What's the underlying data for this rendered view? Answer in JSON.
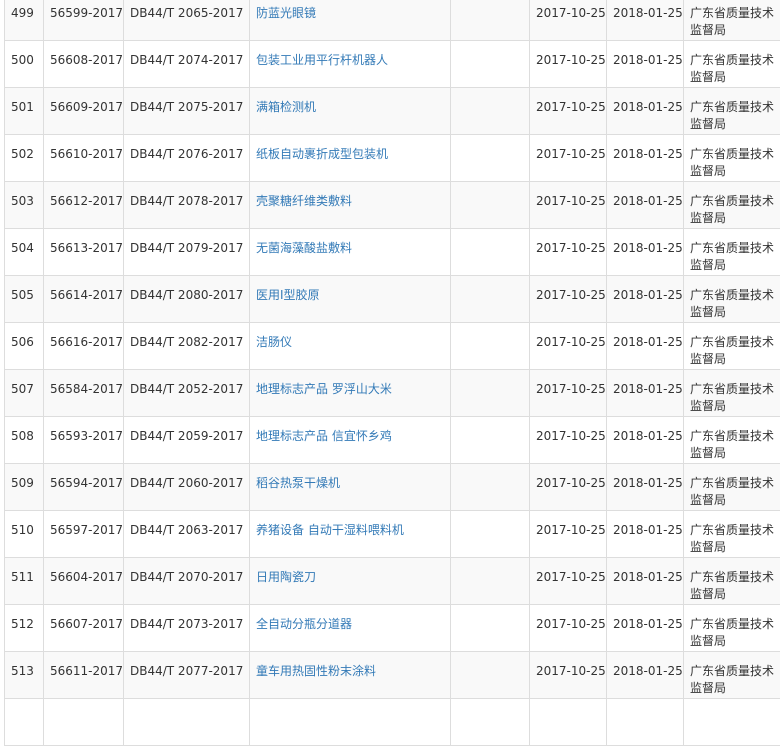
{
  "rows": [
    {
      "no": "499",
      "record": "56599-2017",
      "code": "DB44/T 2065-2017",
      "name": "防蓝光眼镜",
      "published": "2017-10-25",
      "implemented": "2018-01-25",
      "dept": "广东省质量技术监督局"
    },
    {
      "no": "500",
      "record": "56608-2017",
      "code": "DB44/T 2074-2017",
      "name": "包装工业用平行杆机器人",
      "published": "2017-10-25",
      "implemented": "2018-01-25",
      "dept": "广东省质量技术监督局"
    },
    {
      "no": "501",
      "record": "56609-2017",
      "code": "DB44/T 2075-2017",
      "name": "满箱检测机",
      "published": "2017-10-25",
      "implemented": "2018-01-25",
      "dept": "广东省质量技术监督局"
    },
    {
      "no": "502",
      "record": "56610-2017",
      "code": "DB44/T 2076-2017",
      "name": "纸板自动裹折成型包装机",
      "published": "2017-10-25",
      "implemented": "2018-01-25",
      "dept": "广东省质量技术监督局"
    },
    {
      "no": "503",
      "record": "56612-2017",
      "code": "DB44/T 2078-2017",
      "name": "壳聚糖纤维类敷料",
      "published": "2017-10-25",
      "implemented": "2018-01-25",
      "dept": "广东省质量技术监督局"
    },
    {
      "no": "504",
      "record": "56613-2017",
      "code": "DB44/T 2079-2017",
      "name": "无菌海藻酸盐敷料",
      "published": "2017-10-25",
      "implemented": "2018-01-25",
      "dept": "广东省质量技术监督局"
    },
    {
      "no": "505",
      "record": "56614-2017",
      "code": "DB44/T 2080-2017",
      "name": "医用Ⅰ型胶原",
      "published": "2017-10-25",
      "implemented": "2018-01-25",
      "dept": "广东省质量技术监督局"
    },
    {
      "no": "506",
      "record": "56616-2017",
      "code": "DB44/T 2082-2017",
      "name": "洁肠仪",
      "published": "2017-10-25",
      "implemented": "2018-01-25",
      "dept": "广东省质量技术监督局"
    },
    {
      "no": "507",
      "record": "56584-2017",
      "code": "DB44/T 2052-2017",
      "name": "地理标志产品 罗浮山大米",
      "published": "2017-10-25",
      "implemented": "2018-01-25",
      "dept": "广东省质量技术监督局"
    },
    {
      "no": "508",
      "record": "56593-2017",
      "code": "DB44/T 2059-2017",
      "name": "地理标志产品 信宜怀乡鸡",
      "published": "2017-10-25",
      "implemented": "2018-01-25",
      "dept": "广东省质量技术监督局"
    },
    {
      "no": "509",
      "record": "56594-2017",
      "code": "DB44/T 2060-2017",
      "name": "稻谷热泵干燥机",
      "published": "2017-10-25",
      "implemented": "2018-01-25",
      "dept": "广东省质量技术监督局"
    },
    {
      "no": "510",
      "record": "56597-2017",
      "code": "DB44/T 2063-2017",
      "name": "养猪设备 自动干湿料喂料机",
      "published": "2017-10-25",
      "implemented": "2018-01-25",
      "dept": "广东省质量技术监督局"
    },
    {
      "no": "511",
      "record": "56604-2017",
      "code": "DB44/T 2070-2017",
      "name": "日用陶瓷刀",
      "published": "2017-10-25",
      "implemented": "2018-01-25",
      "dept": "广东省质量技术监督局"
    },
    {
      "no": "512",
      "record": "56607-2017",
      "code": "DB44/T 2073-2017",
      "name": "全自动分瓶分道器",
      "published": "2017-10-25",
      "implemented": "2018-01-25",
      "dept": "广东省质量技术监督局"
    },
    {
      "no": "513",
      "record": "56611-2017",
      "code": "DB44/T 2077-2017",
      "name": "童车用热固性粉末涂料",
      "published": "2017-10-25",
      "implemented": "2018-01-25",
      "dept": "广东省质量技术监督局"
    },
    {
      "no": "",
      "record": "",
      "code": "",
      "name": "",
      "published": "",
      "implemented": "",
      "dept": ""
    }
  ]
}
